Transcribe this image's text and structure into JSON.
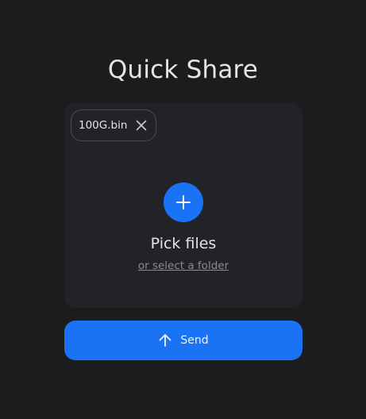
{
  "app": {
    "title": "Quick Share"
  },
  "dropzone": {
    "files": [
      {
        "name": "100G.bin",
        "remove_icon": "close-icon"
      }
    ],
    "add_icon": "plus-icon",
    "pick_label": "Pick files",
    "folder_link": "or select a folder"
  },
  "send": {
    "icon": "arrow-up-icon",
    "label": "Send"
  },
  "colors": {
    "background": "#1b1c1e",
    "panel": "#222327",
    "accent": "#1a73f5",
    "text": "#e4e5e7",
    "muted": "#8a8c91"
  }
}
